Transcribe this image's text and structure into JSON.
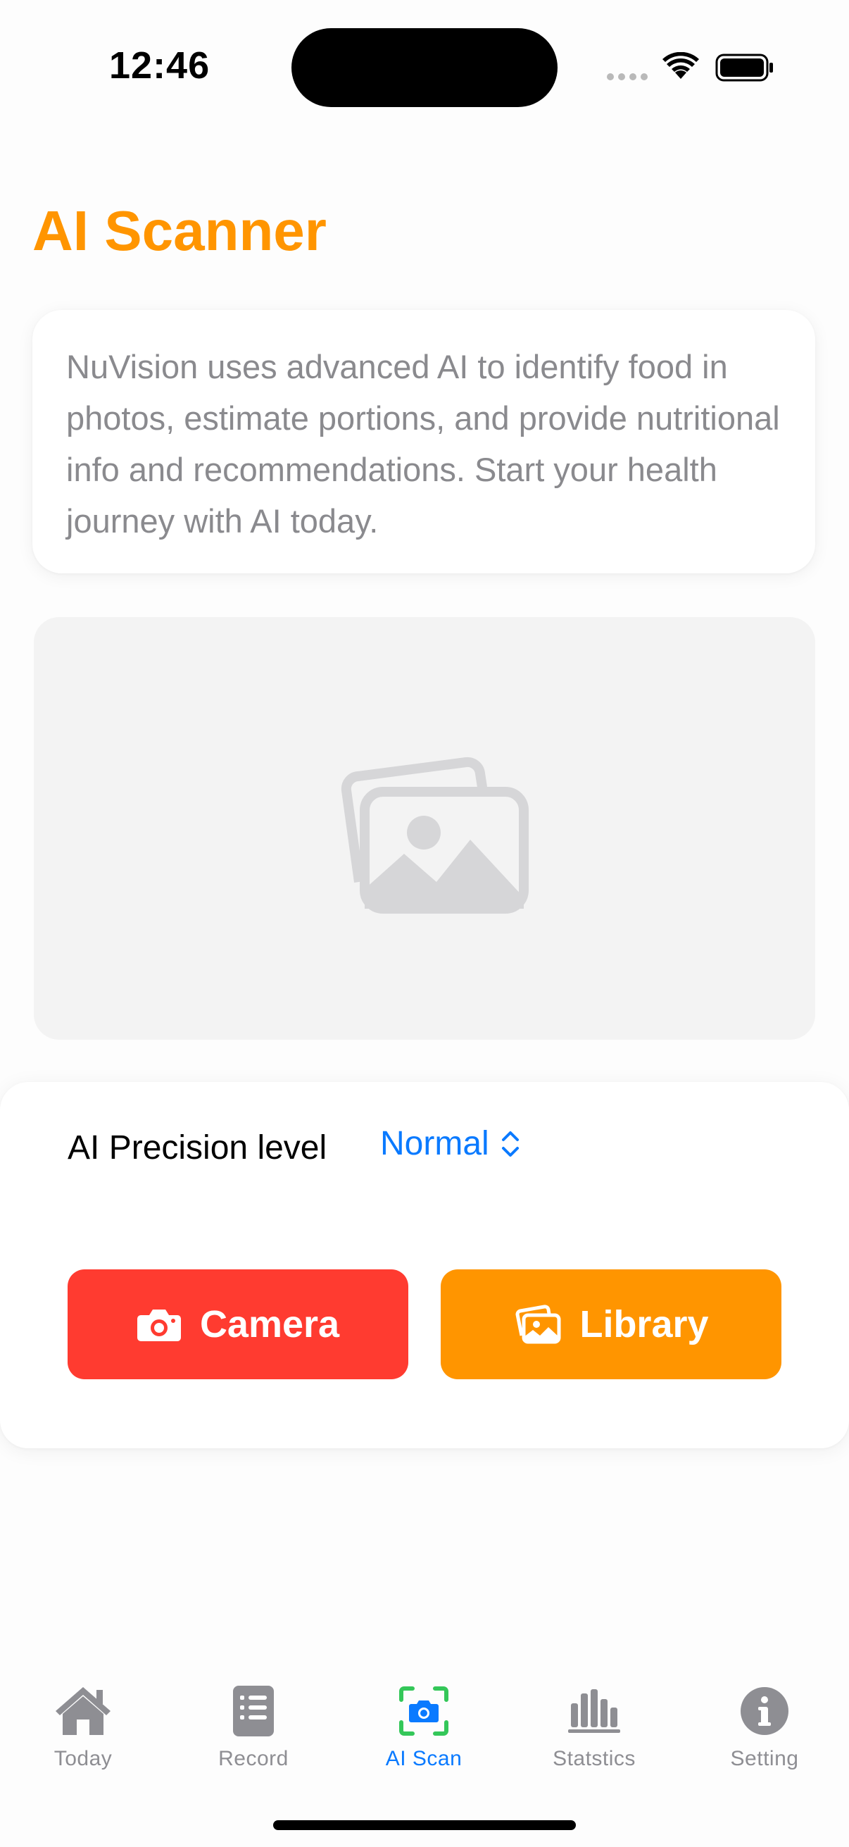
{
  "status_bar": {
    "time": "12:46"
  },
  "page": {
    "title": "AI Scanner"
  },
  "info_card": {
    "text": "NuVision uses advanced AI to identify food in photos, estimate portions, and provide nutritional info and recommendations. Start your health journey with AI today."
  },
  "photo_preview": {
    "icon": "photo-stack-icon"
  },
  "controls": {
    "precision_label": "AI Precision level",
    "precision_value": "Normal",
    "camera_button": "Camera",
    "library_button": "Library"
  },
  "tab_bar": {
    "active_index": 2,
    "items": [
      {
        "label": "Today",
        "icon": "house-icon"
      },
      {
        "label": "Record",
        "icon": "list-icon"
      },
      {
        "label": "AI Scan",
        "icon": "camera-scan-icon"
      },
      {
        "label": "Statstics",
        "icon": "bar-chart-icon"
      },
      {
        "label": "Setting",
        "icon": "info-icon"
      }
    ]
  },
  "colors": {
    "accent_orange": "#ff9500",
    "camera_red": "#ff3b30",
    "link_blue": "#0a7aff",
    "muted_gray": "#8e8e93",
    "scan_green": "#34c759"
  }
}
